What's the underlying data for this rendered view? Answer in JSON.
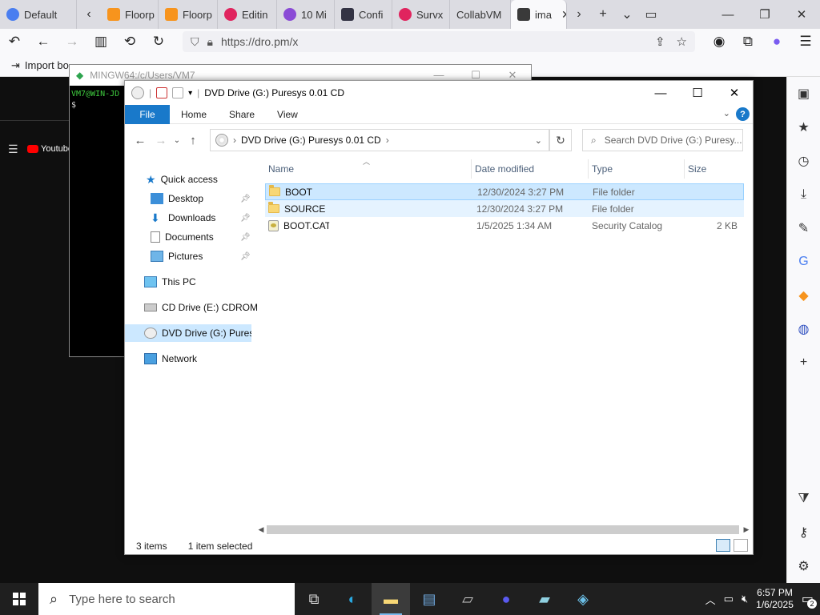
{
  "browser": {
    "tabs": [
      {
        "label": "Default",
        "color": "#4a7ef0"
      },
      {
        "label": "Floorp",
        "color": "#f7941d"
      },
      {
        "label": "Floorp",
        "color": "#f7941d"
      },
      {
        "label": "Editin",
        "color": "#e0245e"
      },
      {
        "label": "10 Mi",
        "color": "#8a4bd6"
      },
      {
        "label": "Confi",
        "color": "#333344"
      },
      {
        "label": "Survx",
        "color": "#e0245e"
      },
      {
        "label": "CollabVM",
        "color": ""
      },
      {
        "label": "ima",
        "color": "#3a3a3a"
      }
    ],
    "url": "https://dro.pm/x",
    "bookmark_label": "Import bo"
  },
  "page": {
    "youtube_label": "Youtube"
  },
  "terminal": {
    "title": "MINGW64:/c/Users/VM7",
    "prompt_user": "VM7@WIN-JD",
    "prompt_symbol": "$"
  },
  "explorer": {
    "title": "DVD Drive (G:) Puresys 0.01 CD",
    "ribbon": {
      "file": "File",
      "home": "Home",
      "share": "Share",
      "view": "View"
    },
    "address": "DVD Drive (G:) Puresys 0.01 CD",
    "search_placeholder": "Search DVD Drive (G:) Puresy...",
    "nav": {
      "quick_access": "Quick access",
      "desktop": "Desktop",
      "downloads": "Downloads",
      "documents": "Documents",
      "pictures": "Pictures",
      "this_pc": "This PC",
      "cd_drive": "CD Drive (E:) CDROM",
      "dvd_drive": "DVD Drive (G:) Puresys",
      "network": "Network"
    },
    "columns": {
      "name": "Name",
      "date": "Date modified",
      "type": "Type",
      "size": "Size"
    },
    "files": [
      {
        "name": "BOOT",
        "date": "12/30/2024 3:27 PM",
        "type": "File folder",
        "size": ""
      },
      {
        "name": "SOURCE",
        "date": "12/30/2024 3:27 PM",
        "type": "File folder",
        "size": ""
      },
      {
        "name": "BOOT.CAT",
        "date": "1/5/2025 1:34 AM",
        "type": "Security Catalog",
        "size": "2 KB"
      }
    ],
    "status": {
      "count": "3 items",
      "selected": "1 item selected"
    }
  },
  "taskbar": {
    "search_placeholder": "Type here to search",
    "time": "6:57 PM",
    "date": "1/6/2025",
    "notification_count": "2"
  }
}
